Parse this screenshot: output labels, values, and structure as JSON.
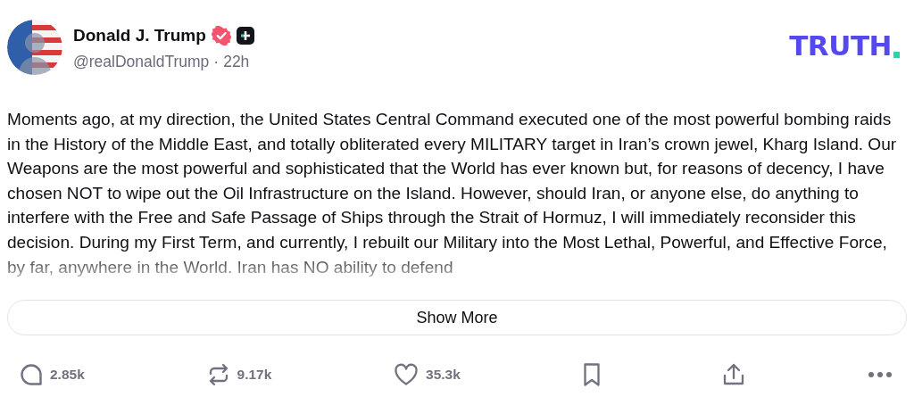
{
  "post": {
    "author": {
      "name": "Donald J. Trump",
      "verified": true,
      "handle": "@realDonaldTrump",
      "separator": "·",
      "time": "22h"
    },
    "logo": {
      "text": "TRUTH"
    },
    "body": "Moments ago, at my direction, the United States Central Command executed one of the most powerful bombing raids in the History of the Middle East, and totally obliterated every MILITARY target in Iran’s crown jewel, Kharg Island. Our Weapons are the most powerful and sophisticated that the World has ever known but, for reasons of decency, I have chosen NOT to wipe out the Oil Infrastructure on the Island. However, should Iran, or anyone else, do anything to interfere with the Free and Safe Passage of Ships through the Strait of Hormuz, I will immediately reconsider this decision. During my First Term, and currently, I rebuilt our Military into the Most Lethal, Powerful, and Effective Force, by far, anywhere in the World. Iran has NO ability to defend",
    "show_more": "Show More",
    "actions": [
      {
        "kind": "reply",
        "count": "2.85k"
      },
      {
        "kind": "repost",
        "count": "9.17k"
      },
      {
        "kind": "like",
        "count": "35.3k"
      },
      {
        "kind": "bookmark"
      },
      {
        "kind": "share"
      },
      {
        "kind": "more"
      }
    ]
  }
}
